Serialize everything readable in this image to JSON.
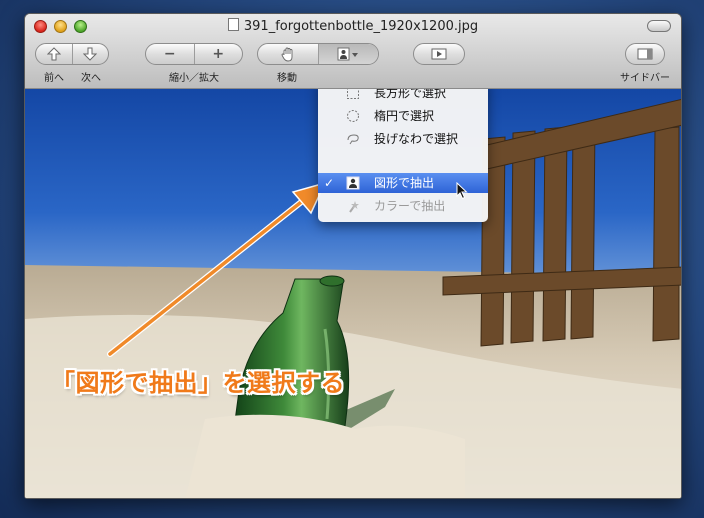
{
  "window": {
    "title": "391_forgottenbottle_1920x1200.jpg"
  },
  "toolbar": {
    "nav_label": "前へ　次へ",
    "prev_label": "前へ",
    "next_label": "次へ",
    "zoom_label": "縮小／拡大",
    "zoom_out_glyph": "−",
    "zoom_in_glyph": "+",
    "move_label": "移動",
    "sidebar_label": "サイドバー"
  },
  "selection_menu": {
    "items": [
      {
        "label": "長方形で選択",
        "icon": "rectangle-select-icon",
        "state": "normal"
      },
      {
        "label": "楕円で選択",
        "icon": "ellipse-select-icon",
        "state": "normal"
      },
      {
        "label": "投げなわで選択",
        "icon": "lasso-select-icon",
        "state": "normal"
      },
      {
        "label": "図形で抽出",
        "icon": "shape-extract-icon",
        "state": "selected",
        "checked": true
      },
      {
        "label": "カラーで抽出",
        "icon": "color-extract-icon",
        "state": "disabled"
      }
    ],
    "check_glyph": "✓"
  },
  "annotation": {
    "text": "「図形で抽出」を選択する",
    "color": "#f07a1a"
  },
  "colors": {
    "menu_highlight": "#2e63d6",
    "annotation_arrow": "#f08a2a"
  }
}
